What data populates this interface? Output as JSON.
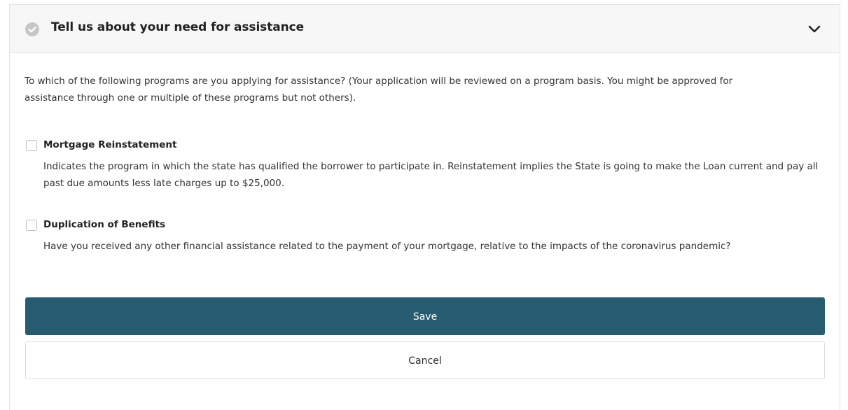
{
  "section": {
    "title": "Tell us about your need for assistance",
    "status_icon": "check-circle-icon",
    "toggle_icon": "chevron-down-icon"
  },
  "intro_text": "To which of the following programs are you applying for assistance? (Your application will be reviewed on a program basis. You might be approved for assistance through one or multiple of these programs but not others).",
  "options": [
    {
      "label": "Mortgage Reinstatement",
      "description": "Indicates the program in which the state has qualified the borrower to participate in. Reinstatement implies the State is going to make the Loan current and pay all past due amounts less late charges up to $25,000.",
      "checked": false
    },
    {
      "label": "Duplication of Benefits",
      "description": "Have you received any other financial assistance related to the payment of your mortgage, relative to the impacts of the coronavirus pandemic?",
      "checked": false
    }
  ],
  "actions": {
    "save_label": "Save",
    "cancel_label": "Cancel"
  },
  "colors": {
    "primary_button": "#275b70",
    "header_background": "#f7f7f7",
    "status_icon": "#c6c6c6"
  }
}
